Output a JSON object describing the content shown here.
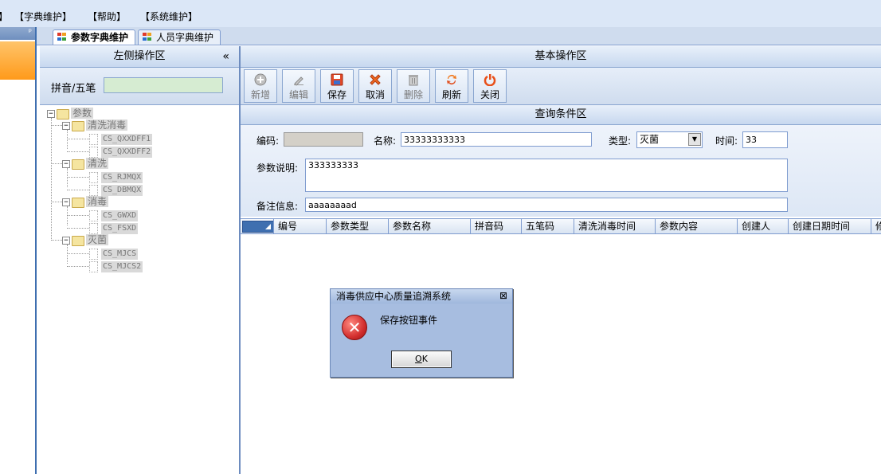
{
  "menu": [
    "】",
    "【字典维护】",
    "【帮助】",
    "【系统维护】"
  ],
  "left_strip": {
    "pin": "ᵖ"
  },
  "tabs": [
    {
      "label": "参数字典维护",
      "active": true
    },
    {
      "label": "人员字典维护",
      "active": false
    }
  ],
  "left_panel": {
    "title": "左侧操作区",
    "collapse_glyph": "«",
    "search_label": "拼音/五笔",
    "search_value": ""
  },
  "tree": {
    "root": "参数",
    "groups": [
      {
        "label": "清洗消毒",
        "children": [
          "CS_QXXDFF1",
          "CS_QXXDFF2"
        ]
      },
      {
        "label": "清洗",
        "children": [
          "CS_RJMQX",
          "CS_DBMQX"
        ]
      },
      {
        "label": "消毒",
        "children": [
          "CS_GWXD",
          "CS_FSXD"
        ]
      },
      {
        "label": "灭菌",
        "children": [
          "CS_MJCS",
          "CS_MJCS2"
        ]
      }
    ]
  },
  "right_panel": {
    "title": "基本操作区"
  },
  "toolbar": {
    "add": "新增",
    "edit": "编辑",
    "save": "保存",
    "cancel": "取消",
    "delete": "删除",
    "refresh": "刷新",
    "close": "关闭"
  },
  "query": {
    "title": "查询条件区",
    "code_label": "编码:",
    "code_value": "",
    "name_label": "名称:",
    "name_value": "33333333333",
    "type_label": "类型:",
    "type_value": "灭菌",
    "time_label": "时间:",
    "time_value": "33",
    "desc_label": "参数说明:",
    "desc_value": "333333333",
    "note_label": "备注信息:",
    "note_value": "aaaaaaaad"
  },
  "grid": {
    "columns": [
      "编号",
      "参数类型",
      "参数名称",
      "拼音码",
      "五笔码",
      "清洗消毒时间",
      "参数内容",
      "创建人",
      "创建日期时间",
      "修"
    ]
  },
  "dialog": {
    "title": "消毒供应中心质量追溯系统",
    "close_glyph": "⊠",
    "message": "保存按钮事件",
    "ok_prefix": "",
    "ok_underlined": "O",
    "ok_rest": "K"
  },
  "colors": {
    "accent": "#3f6fb0",
    "header_bg": "#c7d8ef",
    "search_bg": "#d6ecd2",
    "orange": "#ff9a1a"
  }
}
